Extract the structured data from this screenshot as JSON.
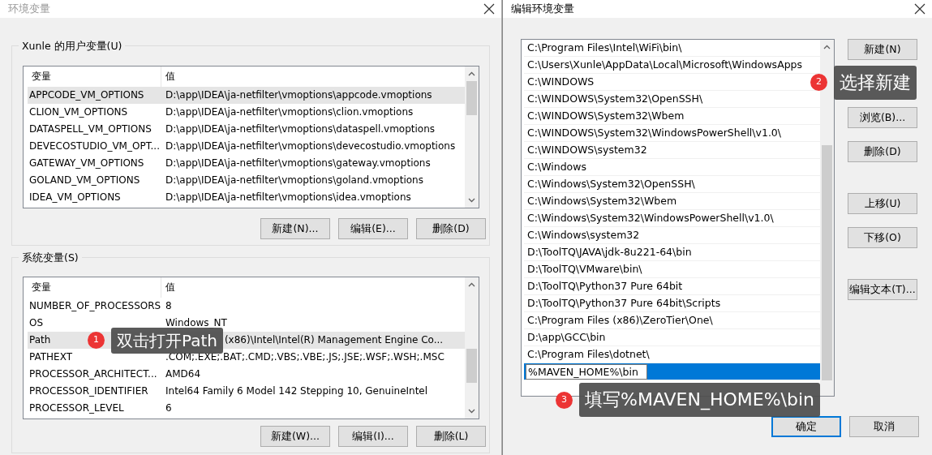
{
  "env_dialog": {
    "title": "环境变量",
    "user_variables": {
      "label": "Xunle 的用户变量(U)",
      "columns": [
        "变量",
        "值"
      ],
      "rows": [
        {
          "name": "APPCODE_VM_OPTIONS",
          "value": "D:\\app\\IDEA\\ja-netfilter\\vmoptions\\appcode.vmoptions",
          "selected": true
        },
        {
          "name": "CLION_VM_OPTIONS",
          "value": "D:\\app\\IDEA\\ja-netfilter\\vmoptions\\clion.vmoptions",
          "selected": false
        },
        {
          "name": "DATASPELL_VM_OPTIONS",
          "value": "D:\\app\\IDEA\\ja-netfilter\\vmoptions\\dataspell.vmoptions",
          "selected": false
        },
        {
          "name": "DEVECOSTUDIO_VM_OPT...",
          "value": "D:\\app\\IDEA\\ja-netfilter\\vmoptions\\devecostudio.vmoptions",
          "selected": false
        },
        {
          "name": "GATEWAY_VM_OPTIONS",
          "value": "D:\\app\\IDEA\\ja-netfilter\\vmoptions\\gateway.vmoptions",
          "selected": false
        },
        {
          "name": "GOLAND_VM_OPTIONS",
          "value": "D:\\app\\IDEA\\ja-netfilter\\vmoptions\\goland.vmoptions",
          "selected": false
        },
        {
          "name": "IDEA_VM_OPTIONS",
          "value": "D:\\app\\IDEA\\ja-netfilter\\vmoptions\\idea.vmoptions",
          "selected": false
        }
      ],
      "buttons": [
        "新建(N)...",
        "编辑(E)...",
        "删除(D)"
      ]
    },
    "system_variables": {
      "label": "系统变量(S)",
      "columns": [
        "变量",
        "值"
      ],
      "rows": [
        {
          "name": "NUMBER_OF_PROCESSORS",
          "value": "8",
          "selected": false
        },
        {
          "name": "OS",
          "value": "Windows_NT",
          "selected": false
        },
        {
          "name": "Path",
          "value": "(x86)\\Intel\\Intel(R) Management Engine Co...",
          "selected": true
        },
        {
          "name": "PATHEXT",
          "value": ".COM;.EXE;.BAT;.CMD;.VBS;.VBE;.JS;.JSE;.WSF;.WSH;.MSC",
          "selected": false
        },
        {
          "name": "PROCESSOR_ARCHITECT...",
          "value": "AMD64",
          "selected": false
        },
        {
          "name": "PROCESSOR_IDENTIFIER",
          "value": "Intel64 Family 6 Model 142 Stepping 10, GenuineIntel",
          "selected": false
        },
        {
          "name": "PROCESSOR_LEVEL",
          "value": "6",
          "selected": false
        }
      ],
      "buttons": [
        "新建(W)...",
        "编辑(I)...",
        "删除(L)"
      ]
    }
  },
  "edit_dialog": {
    "title": "编辑环境变量",
    "entries": [
      {
        "kind": "item",
        "text": "C:\\Program Files\\Intel\\WiFi\\bin\\",
        "selected": false
      },
      {
        "kind": "item",
        "text": "C:\\Users\\Xunle\\AppData\\Local\\Microsoft\\WindowsApps",
        "selected": false
      },
      {
        "kind": "item",
        "text": "C:\\WINDOWS",
        "selected": false
      },
      {
        "kind": "item",
        "text": "C:\\WINDOWS\\System32\\OpenSSH\\",
        "selected": false
      },
      {
        "kind": "item",
        "text": "C:\\WINDOWS\\System32\\Wbem",
        "selected": false
      },
      {
        "kind": "item",
        "text": "C:\\WINDOWS\\System32\\WindowsPowerShell\\v1.0\\",
        "selected": false
      },
      {
        "kind": "item",
        "text": "C:\\WINDOWS\\system32",
        "selected": false
      },
      {
        "kind": "item",
        "text": "C:\\Windows",
        "selected": false
      },
      {
        "kind": "item",
        "text": "C:\\Windows\\System32\\OpenSSH\\",
        "selected": false
      },
      {
        "kind": "item",
        "text": "C:\\Windows\\System32\\Wbem",
        "selected": false
      },
      {
        "kind": "item",
        "text": "C:\\Windows\\System32\\WindowsPowerShell\\v1.0\\",
        "selected": false
      },
      {
        "kind": "item",
        "text": "C:\\Windows\\system32",
        "selected": false
      },
      {
        "kind": "item",
        "text": "D:\\ToolTQ\\JAVA\\jdk-8u221-64\\bin",
        "selected": false
      },
      {
        "kind": "item",
        "text": "D:\\ToolTQ\\VMware\\bin\\",
        "selected": false
      },
      {
        "kind": "item",
        "text": "D:\\ToolTQ\\Python37 Pure 64bit",
        "selected": false
      },
      {
        "kind": "item",
        "text": "D:\\ToolTQ\\Python37 Pure 64bit\\Scripts",
        "selected": false
      },
      {
        "kind": "item",
        "text": "C:\\Program Files (x86)\\ZeroTier\\One\\",
        "selected": false
      },
      {
        "kind": "item",
        "text": "D:\\app\\GCC\\bin",
        "selected": false
      },
      {
        "kind": "item",
        "text": "C:\\Program Files\\dotnet\\",
        "selected": false
      },
      {
        "kind": "editing",
        "text": "%MAVEN_HOME%\\bin",
        "selected": true
      }
    ],
    "side_button_groups": [
      [
        "新建(N)"
      ],
      [
        "浏览(B)...",
        "删除(D)"
      ],
      [
        "上移(U)",
        "下移(O)"
      ],
      [
        "编辑文本(T)..."
      ]
    ],
    "footer_buttons": [
      {
        "label": "确定",
        "default": true
      },
      {
        "label": "取消",
        "default": false
      }
    ]
  },
  "annotations": [
    {
      "number": "1",
      "text": "双击打开Path"
    },
    {
      "number": "2",
      "text": "选择新建"
    },
    {
      "number": "3",
      "text": "填写%MAVEN_HOME%\\bin"
    }
  ]
}
